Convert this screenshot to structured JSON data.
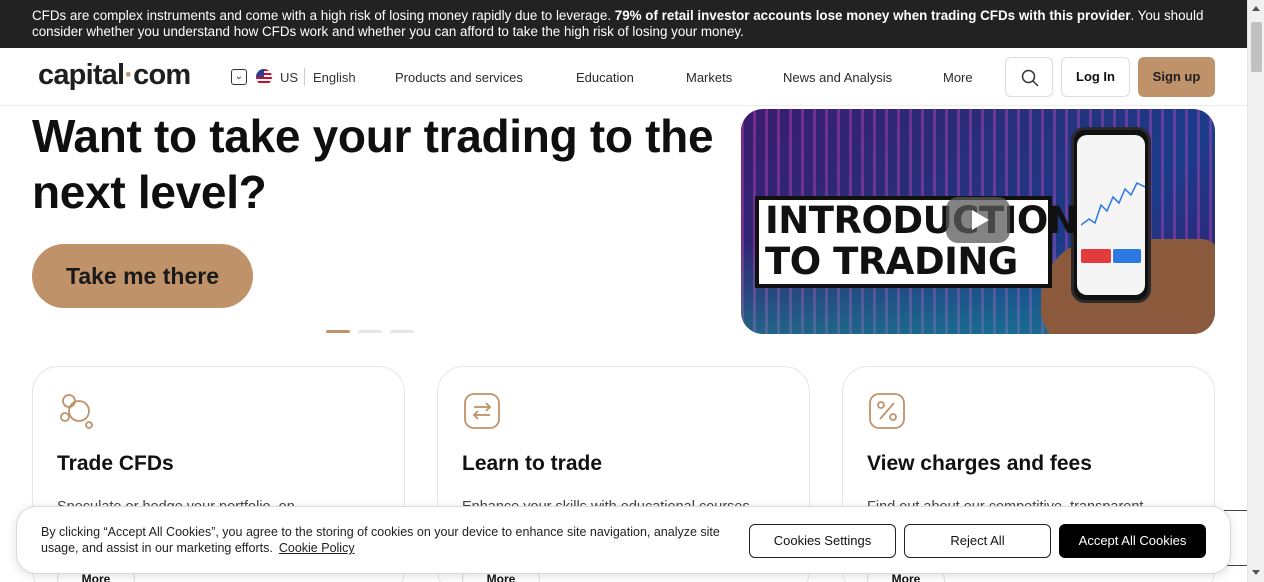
{
  "risk_warning": {
    "text_before": "CFDs are complex instruments and come with a high risk of losing money rapidly due to leverage.",
    "text_bold": "79% of retail investor accounts lose money when trading CFDs with this provider",
    "text_after": ". You should consider whether you understand how CFDs work and whether you can afford to take the high risk of losing your money."
  },
  "header": {
    "logo_left": "capital",
    "logo_dot": "·",
    "logo_right": "com",
    "locale_toggle_icon": "chevron-down-icon",
    "country": "US",
    "language": "English",
    "nav": [
      "Products and services",
      "Education",
      "Markets",
      "News and Analysis",
      "More"
    ],
    "search_icon": "search-icon",
    "login_label": "Log In",
    "signup_label": "Sign up"
  },
  "hero": {
    "title": "Want to take your trading to the next level?",
    "cta_label": "Take me there",
    "slides_total": 3,
    "slide_active": 1,
    "video": {
      "line1": "INTRODUCTION",
      "line2": "TO TRADING",
      "play_icon": "play-icon"
    }
  },
  "cards": [
    {
      "icon": "circles-icon",
      "title": "Trade CFDs",
      "desc": "Speculate or hedge your portfolio, on",
      "more": "More"
    },
    {
      "icon": "arrows-exchange-icon",
      "title": "Learn to trade",
      "desc": "Enhance your skills with educational courses",
      "more": "More"
    },
    {
      "icon": "percent-icon",
      "title": "View charges and fees",
      "desc": "Find out about our competitive, transparent",
      "more": "More"
    }
  ],
  "cookie_banner": {
    "text": "By clicking “Accept All Cookies”, you agree to the storing of cookies on your device to enhance site navigation, analyze site usage, and assist in our marketing efforts.",
    "policy_link": "Cookie Policy",
    "settings_label": "Cookies Settings",
    "reject_label": "Reject All",
    "accept_label": "Accept All Cookies"
  },
  "colors": {
    "brand": "#c0926a",
    "banner_bg": "#222222",
    "accept_bg": "#000000"
  }
}
